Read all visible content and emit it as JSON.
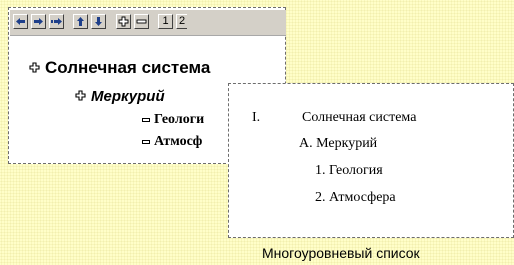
{
  "top_strip": {
    "text": "..."
  },
  "toolbar": {
    "buttons": [
      {
        "name": "promote-icon",
        "icon": "arrow-left"
      },
      {
        "name": "demote-icon",
        "icon": "arrow-right"
      },
      {
        "name": "demote-to-body-icon",
        "icon": "double-arrow-right"
      },
      {
        "name": "move-up-icon",
        "icon": "arrow-up"
      },
      {
        "name": "move-down-icon",
        "icon": "arrow-down"
      },
      {
        "name": "expand-icon",
        "icon": "plus"
      },
      {
        "name": "collapse-icon",
        "icon": "minus"
      }
    ],
    "level_1": "1",
    "level_2": "2"
  },
  "outline": {
    "level1": "Солнечная система",
    "level2": "Меркурий",
    "level3a": "Геологи",
    "level3b": "Атмосф"
  },
  "result_list": {
    "item1_number": "I.",
    "item1_text": "Солнечная система",
    "item2": "А. Меркурий",
    "item3": "1. Геология",
    "item4": "2. Атмосфера"
  },
  "caption": "Многоуровневый список",
  "colors": {
    "background": "#fffec8",
    "toolbar_icons": "#1e3f8a",
    "toolbar": "#d4d0c8"
  }
}
